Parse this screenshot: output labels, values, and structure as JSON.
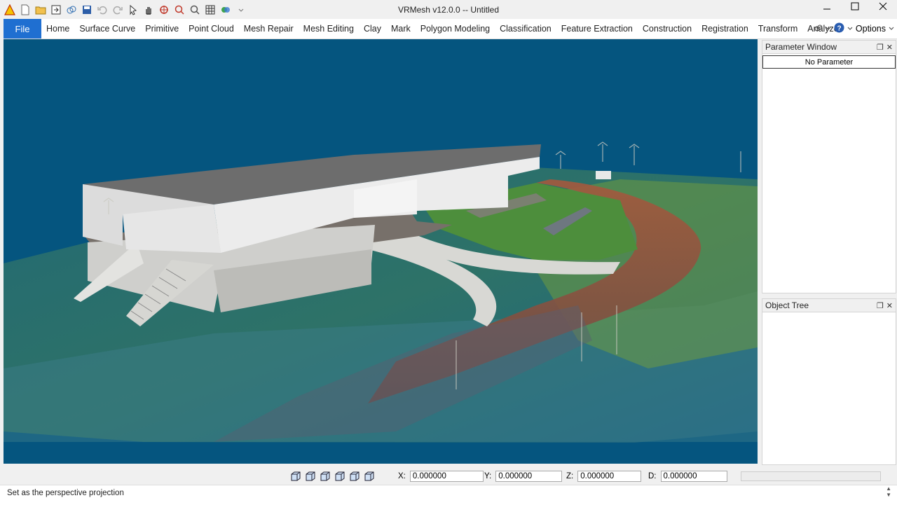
{
  "window": {
    "title": "VRMesh v12.0.0  -- Untitled"
  },
  "quick_access": [
    "warning-icon",
    "new-icon",
    "open-icon",
    "import-icon",
    "link-icon",
    "save-icon",
    "undo-icon",
    "redo-icon",
    "select-icon",
    "pan-icon",
    "rotate-icon",
    "zoom-window-icon",
    "zoom-icon",
    "grid-icon",
    "color-icon",
    "dropdown-icon"
  ],
  "menu": {
    "file": "File",
    "tabs": [
      "Home",
      "Surface Curve",
      "Primitive",
      "Point Cloud",
      "Mesh Repair",
      "Mesh Editing",
      "Clay",
      "Mark",
      "Polygon Modeling",
      "Classification",
      "Feature Extraction",
      "Construction",
      "Registration",
      "Transform",
      "Analyze"
    ],
    "options": "Options"
  },
  "panels": {
    "parameter": {
      "title": "Parameter Window",
      "content": "No Parameter"
    },
    "object_tree": {
      "title": "Object Tree"
    }
  },
  "coords": {
    "x_label": "X:",
    "x_value": "0.000000",
    "y_label": "Y:",
    "y_value": "0.000000",
    "z_label": "Z:",
    "z_value": "0.000000",
    "d_label": "D:",
    "d_value": "0.000000"
  },
  "status": {
    "text": "Set as the perspective projection"
  },
  "colors": {
    "accent": "#1f6fd1",
    "viewport_bg": "#05557f"
  }
}
